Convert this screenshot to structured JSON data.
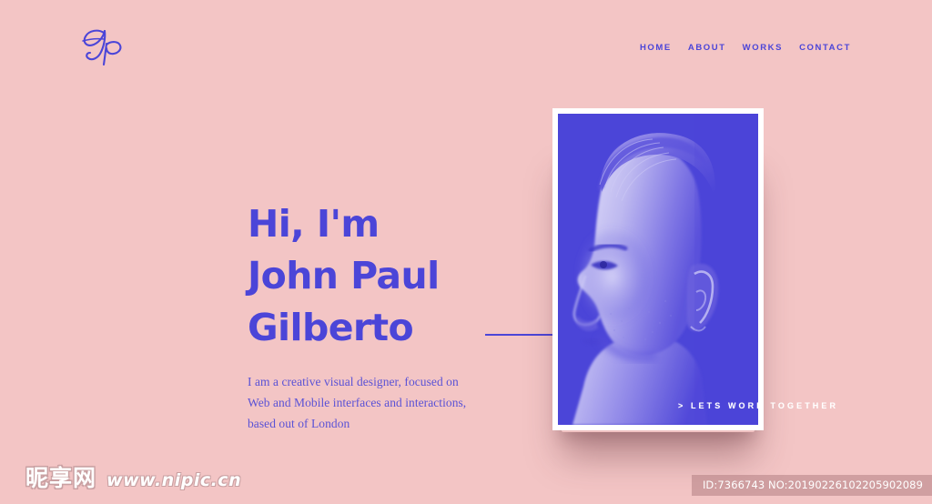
{
  "page": {
    "background_color": "#f3c5c5",
    "accent_color": "#4b45d8",
    "frame_color": "#ffffff"
  },
  "header": {
    "logo": {
      "name": "jp-monogram-logo",
      "text": "Jp",
      "color": "#4b45d8"
    },
    "nav": [
      {
        "label": "HOME",
        "name": "nav-link-home"
      },
      {
        "label": "ABOUT",
        "name": "nav-link-about"
      },
      {
        "label": "WORKS",
        "name": "nav-link-works"
      },
      {
        "label": "CONTACT",
        "name": "nav-link-contact"
      }
    ]
  },
  "hero": {
    "headline_lines": [
      "Hi, I'm",
      "John Paul",
      "Gilberto"
    ],
    "bio_lines": [
      "I am a creative visual designer, focused on",
      "Web and Mobile interfaces and interactions,",
      "based out of London"
    ],
    "cta_label": "> LETS WORK TOGETHER",
    "portrait_alt": "duotone-profile-portrait"
  },
  "watermark": {
    "site_name_cn": "昵享网",
    "site_url": "www.nipic.cn",
    "id_text": "ID:7366743 NO:20190226102205902089"
  }
}
